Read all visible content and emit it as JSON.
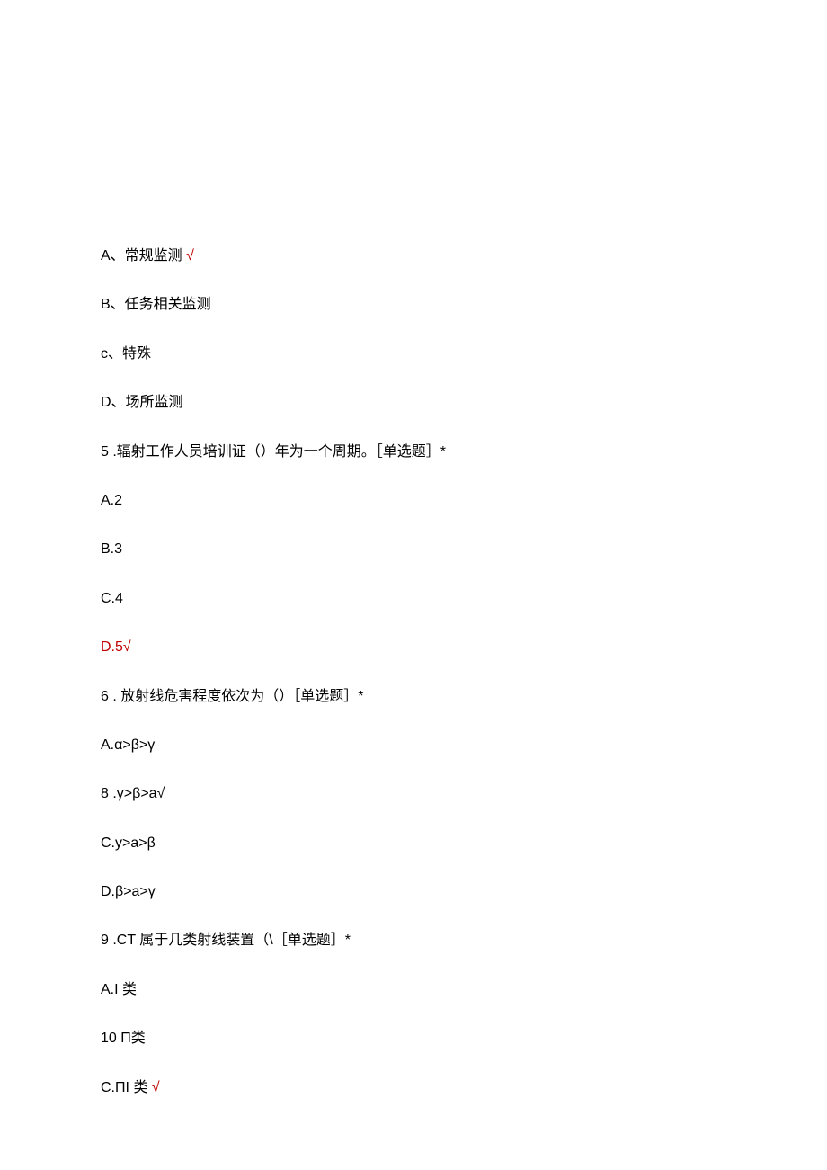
{
  "lines": [
    {
      "text": "A、常规监测 ",
      "correct": false,
      "hasCheck": true
    },
    {
      "text": "B、任务相关监测",
      "correct": false,
      "hasCheck": false
    },
    {
      "text": "c、特殊",
      "correct": false,
      "hasCheck": false
    },
    {
      "text": "D、场所监测",
      "correct": false,
      "hasCheck": false
    },
    {
      "text": "5 .辐射工作人员培训证（）年为一个周期。［单选题］*",
      "correct": false,
      "hasCheck": false
    },
    {
      "text": "A.2",
      "correct": false,
      "hasCheck": false
    },
    {
      "text": "B.3",
      "correct": false,
      "hasCheck": false
    },
    {
      "text": "C.4",
      "correct": false,
      "hasCheck": false
    },
    {
      "text": "D.5√",
      "correct": true,
      "hasCheck": false
    },
    {
      "text": "6 . 放射线危害程度依次为（）［单选题］*",
      "correct": false,
      "hasCheck": false
    },
    {
      "text": "A.α>β>γ",
      "correct": false,
      "hasCheck": false
    },
    {
      "text": "8  .γ>β>a√",
      "correct": false,
      "hasCheck": false
    },
    {
      "text": "C.y>a>β",
      "correct": false,
      "hasCheck": false
    },
    {
      "text": "D.β>a>γ",
      "correct": false,
      "hasCheck": false
    },
    {
      "text": "9  .CT 属于几类射线装置（\\［单选题］*",
      "correct": false,
      "hasCheck": false
    },
    {
      "text": "A.I 类",
      "correct": false,
      "hasCheck": false
    },
    {
      "text": "10  Π类",
      "correct": false,
      "hasCheck": false
    },
    {
      "text": "C.ΠI 类 ",
      "correct": false,
      "hasCheck": true
    }
  ],
  "checkmark": "√"
}
